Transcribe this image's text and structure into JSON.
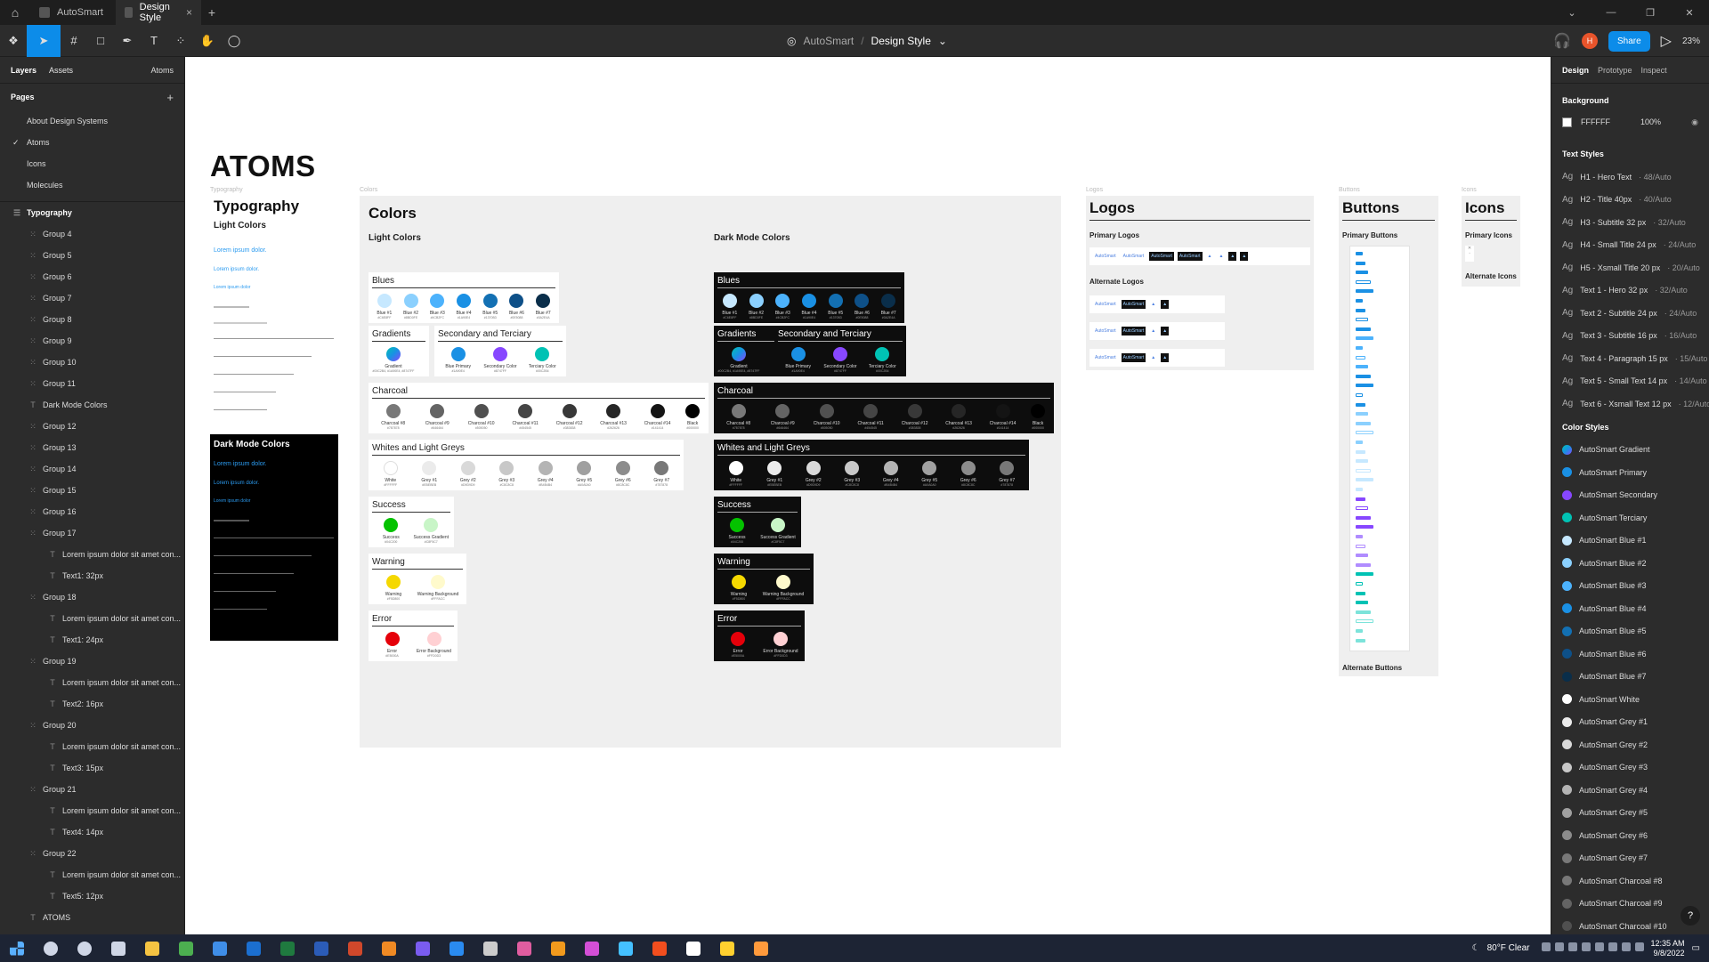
{
  "titlebar": {
    "tabs": [
      {
        "label": "AutoSmart"
      },
      {
        "label": "Design Style"
      }
    ],
    "close_glyph": "×",
    "plus_glyph": "+"
  },
  "toolbar": {
    "team": "AutoSmart",
    "separator": "/",
    "file": "Design Style",
    "avatar_initial": "H",
    "share_label": "Share",
    "zoom": "23%"
  },
  "left_panel": {
    "tab_layers": "Layers",
    "tab_assets": "Assets",
    "page_selector": "Atoms",
    "pages_heading": "Pages",
    "pages": [
      "About Design Systems",
      "Atoms",
      "Icons",
      "Molecules"
    ],
    "current_page_index": 1,
    "layers": [
      {
        "label": "Typography",
        "icon": "frame",
        "top": true
      },
      {
        "label": "Group 4",
        "icon": "group"
      },
      {
        "label": "Group 5",
        "icon": "group"
      },
      {
        "label": "Group 6",
        "icon": "group"
      },
      {
        "label": "Group 7",
        "icon": "group"
      },
      {
        "label": "Group 8",
        "icon": "group"
      },
      {
        "label": "Group 9",
        "icon": "group"
      },
      {
        "label": "Group 10",
        "icon": "group"
      },
      {
        "label": "Group 11",
        "icon": "group"
      },
      {
        "label": "Dark Mode Colors",
        "icon": "text"
      },
      {
        "label": "Group 12",
        "icon": "group"
      },
      {
        "label": "Group 13",
        "icon": "group"
      },
      {
        "label": "Group 14",
        "icon": "group"
      },
      {
        "label": "Group 15",
        "icon": "group"
      },
      {
        "label": "Group 16",
        "icon": "group"
      },
      {
        "label": "Group 17",
        "icon": "group"
      },
      {
        "label": "Lorem ipsum dolor sit amet con...",
        "icon": "text",
        "indent": true
      },
      {
        "label": "Text1: 32px",
        "icon": "text",
        "indent": true
      },
      {
        "label": "Group 18",
        "icon": "group"
      },
      {
        "label": "Lorem ipsum dolor sit amet con...",
        "icon": "text",
        "indent": true
      },
      {
        "label": "Text1: 24px",
        "icon": "text",
        "indent": true
      },
      {
        "label": "Group 19",
        "icon": "group"
      },
      {
        "label": "Lorem ipsum dolor sit amet con...",
        "icon": "text",
        "indent": true
      },
      {
        "label": "Text2: 16px",
        "icon": "text",
        "indent": true
      },
      {
        "label": "Group 20",
        "icon": "group"
      },
      {
        "label": "Lorem ipsum dolor sit amet con...",
        "icon": "text",
        "indent": true
      },
      {
        "label": "Text3: 15px",
        "icon": "text",
        "indent": true
      },
      {
        "label": "Group 21",
        "icon": "group"
      },
      {
        "label": "Lorem ipsum dolor sit amet con...",
        "icon": "text",
        "indent": true
      },
      {
        "label": "Text4: 14px",
        "icon": "text",
        "indent": true
      },
      {
        "label": "Group 22",
        "icon": "group"
      },
      {
        "label": "Lorem ipsum dolor sit amet con...",
        "icon": "text",
        "indent": true
      },
      {
        "label": "Text5: 12px",
        "icon": "text",
        "indent": true
      },
      {
        "label": "ATOMS",
        "icon": "text"
      }
    ]
  },
  "canvas": {
    "page_title": "ATOMS",
    "frame_labels": {
      "typography": "Typography",
      "colors": "Colors",
      "logos": "Logos",
      "buttons": "Buttons",
      "icons": "Icons"
    },
    "typography": {
      "title": "Typography",
      "light_heading": "Light Colors",
      "dark_heading": "Dark Mode Colors",
      "sample_1": "Lorem ipsum dolor.",
      "sample_2": "Lorem ipsum dolor.",
      "sample_3": "Lorem ipsum dolor"
    },
    "colors": {
      "title": "Colors",
      "light_heading": "Light Colors",
      "dark_heading": "Dark Mode Colors",
      "groups": [
        {
          "name": "Blues",
          "swatches": [
            {
              "n": "Blue #1",
              "h": "#C6E8FF",
              "c": "#c6e8ff"
            },
            {
              "n": "Blue #2",
              "h": "#8BD0FE",
              "c": "#8bd0fe"
            },
            {
              "n": "Blue #3",
              "h": "#4CB2FC",
              "c": "#4cb2fc"
            },
            {
              "n": "Blue #4",
              "h": "#1A90E4",
              "c": "#1a90e4"
            },
            {
              "n": "Blue #5",
              "h": "#1370B3",
              "c": "#1370b3"
            },
            {
              "n": "Blue #6",
              "h": "#0E5088",
              "c": "#0e5088"
            },
            {
              "n": "Blue #7",
              "h": "#0A2E4A",
              "c": "#0a2e4a"
            }
          ]
        },
        {
          "name": "Gradients",
          "swatches": [
            {
              "n": "Gradient",
              "h": "#00C2B4, #1A90E4, #8747FF",
              "c": "linear-gradient(135deg,#00c2b4,#1a90e4,#8747ff)",
              "wide": true
            }
          ]
        },
        {
          "name": "Secondary and Terciary",
          "swatches": [
            {
              "n": "Blue Primary",
              "h": "#1A90E4",
              "c": "#1a90e4",
              "wide": true
            },
            {
              "n": "Secondary Color",
              "h": "#8747FF",
              "c": "#8747ff",
              "wide": true
            },
            {
              "n": "Terciary Color",
              "h": "#00C2B4",
              "c": "#00c2b4",
              "wide": true
            }
          ]
        },
        {
          "name": "Charcoal",
          "swatches": [
            {
              "n": "Charcoal #8",
              "h": "#787878",
              "c": "#787878",
              "wide": true
            },
            {
              "n": "Charcoal #9",
              "h": "#646464",
              "c": "#646464",
              "wide": true
            },
            {
              "n": "Charcoal #10",
              "h": "#505050",
              "c": "#505050",
              "wide": true
            },
            {
              "n": "Charcoal #11",
              "h": "#454545",
              "c": "#454545",
              "wide": true
            },
            {
              "n": "Charcoal #12",
              "h": "#383838",
              "c": "#383838",
              "wide": true
            },
            {
              "n": "Charcoal #13",
              "h": "#262626",
              "c": "#262626",
              "wide": true
            },
            {
              "n": "Charcoal #14",
              "h": "#141414",
              "c": "#141414",
              "wide": true
            },
            {
              "n": "Black",
              "h": "#000000",
              "c": "#000000"
            }
          ]
        },
        {
          "name": "Whites and Light Greys",
          "swatches": [
            {
              "n": "White",
              "h": "#FFFFFF",
              "c": "#ffffff",
              "wide": true
            },
            {
              "n": "Grey #1",
              "h": "#EBEBEB",
              "c": "#ebebeb",
              "wide": true
            },
            {
              "n": "Grey #2",
              "h": "#D9D9D9",
              "c": "#d9d9d9",
              "wide": true
            },
            {
              "n": "Grey #3",
              "h": "#C8C8C8",
              "c": "#c8c8c8",
              "wide": true
            },
            {
              "n": "Grey #4",
              "h": "#B4B4B4",
              "c": "#b4b4b4",
              "wide": true
            },
            {
              "n": "Grey #5",
              "h": "#A0A0A0",
              "c": "#a0a0a0",
              "wide": true
            },
            {
              "n": "Grey #6",
              "h": "#8C8C8C",
              "c": "#8c8c8c",
              "wide": true
            },
            {
              "n": "Grey #7",
              "h": "#787878",
              "c": "#787878",
              "wide": true
            }
          ]
        },
        {
          "name": "Success",
          "swatches": [
            {
              "n": "Success",
              "h": "#04C200",
              "c": "#04c200",
              "wide": true
            },
            {
              "n": "Success Gradient",
              "h": "#C8F5C7",
              "c": "#c8f5c7",
              "wide": true
            }
          ]
        },
        {
          "name": "Warning",
          "swatches": [
            {
              "n": "Warning",
              "h": "#F5D800",
              "c": "#f5d800",
              "wide": true
            },
            {
              "n": "Warning Background",
              "h": "#FFFACC",
              "c": "#fffacc",
              "wide": true
            }
          ]
        },
        {
          "name": "Error",
          "swatches": [
            {
              "n": "Error",
              "h": "#E5000A",
              "c": "#e5000a",
              "wide": true
            },
            {
              "n": "Error Background",
              "h": "#FFD0D3",
              "c": "#ffd0d3",
              "wide": true
            }
          ]
        }
      ]
    },
    "logos": {
      "title": "Logos",
      "primary": "Primary Logos",
      "alternate": "Alternate Logos",
      "brand": "AutoSmart"
    },
    "buttons": {
      "title": "Buttons",
      "primary": "Primary Buttons",
      "alternate": "Alternate Buttons"
    },
    "icons": {
      "title": "Icons",
      "primary": "Primary Icons",
      "alternate": "Alternate Icons"
    }
  },
  "right_panel": {
    "tabs": [
      "Design",
      "Prototype",
      "Inspect"
    ],
    "background_heading": "Background",
    "background_hex": "FFFFFF",
    "background_opacity": "100%",
    "text_styles_heading": "Text Styles",
    "text_styles": [
      {
        "name": "H1 - Hero Text",
        "meta": " · 48/Auto"
      },
      {
        "name": "H2 - Title 40px",
        "meta": " · 40/Auto"
      },
      {
        "name": "H3 - Subtitle 32 px",
        "meta": " · 32/Auto"
      },
      {
        "name": "H4 - Small Title 24 px",
        "meta": " · 24/Auto"
      },
      {
        "name": "H5 - Xsmall Title 20 px",
        "meta": " · 20/Auto"
      },
      {
        "name": "Text 1 - Hero 32 px",
        "meta": " · 32/Auto"
      },
      {
        "name": "Text 2 - Subtitle 24 px",
        "meta": " · 24/Auto"
      },
      {
        "name": "Text 3 - Subtitle 16 px",
        "meta": " · 16/Auto"
      },
      {
        "name": "Text 4 - Paragraph 15 px",
        "meta": " · 15/Auto"
      },
      {
        "name": "Text 5 - Small Text 14 px",
        "meta": " · 14/Auto"
      },
      {
        "name": "Text 6 - Xsmall Text 12 px",
        "meta": " · 12/Auto"
      }
    ],
    "color_styles_heading": "Color Styles",
    "color_styles": [
      {
        "name": "AutoSmart Gradient",
        "c": "linear-gradient(135deg,#00c2b4,#1a90e4,#8747ff)"
      },
      {
        "name": "AutoSmart Primary",
        "c": "#1a90e4"
      },
      {
        "name": "AutoSmart Secondary",
        "c": "#8747ff"
      },
      {
        "name": "AutoSmart Terciary",
        "c": "#00c2b4"
      },
      {
        "name": "AutoSmart Blue #1",
        "c": "#c6e8ff"
      },
      {
        "name": "AutoSmart Blue #2",
        "c": "#8bd0fe"
      },
      {
        "name": "AutoSmart Blue #3",
        "c": "#4cb2fc"
      },
      {
        "name": "AutoSmart Blue #4",
        "c": "#1a90e4"
      },
      {
        "name": "AutoSmart Blue #5",
        "c": "#1370b3"
      },
      {
        "name": "AutoSmart Blue #6",
        "c": "#0e5088"
      },
      {
        "name": "AutoSmart Blue #7",
        "c": "#0a2e4a"
      },
      {
        "name": "AutoSmart White",
        "c": "#ffffff"
      },
      {
        "name": "AutoSmart Grey #1",
        "c": "#ebebeb"
      },
      {
        "name": "AutoSmart Grey #2",
        "c": "#d9d9d9"
      },
      {
        "name": "AutoSmart Grey #3",
        "c": "#c8c8c8"
      },
      {
        "name": "AutoSmart Grey #4",
        "c": "#b4b4b4"
      },
      {
        "name": "AutoSmart Grey #5",
        "c": "#a0a0a0"
      },
      {
        "name": "AutoSmart Grey #6",
        "c": "#8c8c8c"
      },
      {
        "name": "AutoSmart Grey #7",
        "c": "#787878"
      },
      {
        "name": "AutoSmart Charcoal #8",
        "c": "#787878"
      },
      {
        "name": "AutoSmart Charcoal #9",
        "c": "#646464"
      },
      {
        "name": "AutoSmart Charcoal #10",
        "c": "#505050"
      }
    ],
    "help_glyph": "?"
  },
  "taskbar": {
    "weather": "80°F  Clear",
    "time": "12:35 AM",
    "date": "9/8/2022",
    "apps": [
      {
        "name": "search-icon",
        "color": "#cfd6e6"
      },
      {
        "name": "cortana-icon",
        "color": "#cfd6e6"
      },
      {
        "name": "task-view-icon",
        "color": "#cfd6e6"
      },
      {
        "name": "file-explorer-icon",
        "color": "#f5c342"
      },
      {
        "name": "chrome-icon",
        "color": "#4caf50"
      },
      {
        "name": "store-icon",
        "color": "#3f8ee8"
      },
      {
        "name": "outlook-icon",
        "color": "#1b6fd0"
      },
      {
        "name": "excel-icon",
        "color": "#1f7a3f"
      },
      {
        "name": "word-icon",
        "color": "#2b5cb8"
      },
      {
        "name": "powerpoint-icon",
        "color": "#d0482b"
      },
      {
        "name": "app-icon",
        "color": "#f08a24"
      },
      {
        "name": "app-icon",
        "color": "#7a5cf0"
      },
      {
        "name": "vscode-icon",
        "color": "#2a8bf0"
      },
      {
        "name": "app-icon",
        "color": "#cccccc"
      },
      {
        "name": "app-icon",
        "color": "#e05da0"
      },
      {
        "name": "illustrator-icon",
        "color": "#f29a1d"
      },
      {
        "name": "xd-icon",
        "color": "#d34fd6"
      },
      {
        "name": "app-icon",
        "color": "#44c0ff"
      },
      {
        "name": "figma-icon",
        "color": "#f24e1e"
      },
      {
        "name": "notion-icon",
        "color": "#ffffff"
      },
      {
        "name": "miro-icon",
        "color": "#ffd02f"
      },
      {
        "name": "app-icon",
        "color": "#ff9a3c"
      }
    ]
  }
}
